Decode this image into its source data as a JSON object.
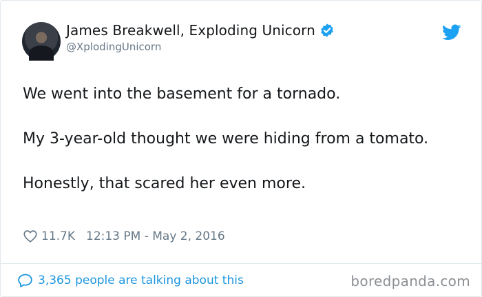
{
  "author": {
    "display_name": "James Breakwell, Exploding Unicorn",
    "handle": "@XplodingUnicorn"
  },
  "tweet": {
    "paragraphs": [
      "We went into the basement for a tornado.",
      "My 3-year-old thought we were hiding from a tomato.",
      "Honestly, that scared her even more."
    ],
    "likes": "11.7K",
    "timestamp": "12:13 PM - May 2, 2016"
  },
  "footer": {
    "talking_text": "3,365 people are talking about this",
    "watermark": "boredpanda.com"
  },
  "icons": {
    "verified": "verified-badge-icon",
    "brand": "twitter-bird-icon",
    "like": "heart-icon",
    "conversation": "speech-bubble-icon"
  },
  "colors": {
    "text": "#14171a",
    "muted": "#657786",
    "accent": "#1da1f2",
    "link": "#1b95e0"
  }
}
